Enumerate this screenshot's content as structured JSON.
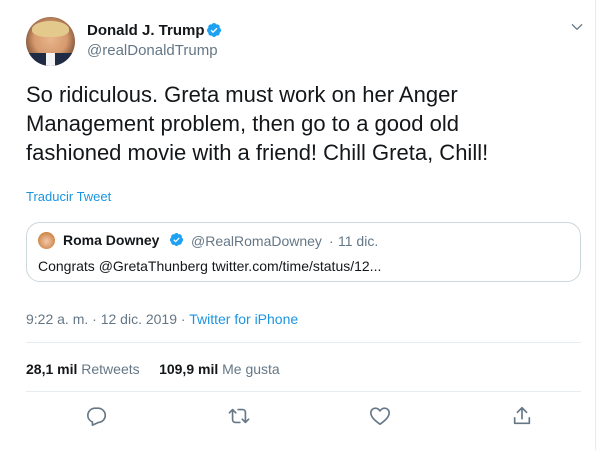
{
  "author": {
    "name": "Donald J. Trump",
    "handle": "@realDonaldTrump",
    "verified": true
  },
  "tweet": {
    "lines": [
      "So ridiculous. Greta must work on her Anger",
      "Management problem, then go to a good old",
      "fashioned movie with a friend! Chill Greta, Chill!"
    ],
    "translate_label": "Traducir Tweet"
  },
  "quoted": {
    "name": "Roma Downey",
    "handle": "@RealRomaDowney",
    "separator": "·",
    "date": "11 dic.",
    "text": "Congrats @GretaThunberg twitter.com/time/status/12..."
  },
  "meta": {
    "time": "9:22 a. m.",
    "separator": "·",
    "date": "12 dic. 2019",
    "separator2": "·",
    "source": "Twitter for iPhone"
  },
  "stats": {
    "retweets_count": "28,1 mil",
    "retweets_label": "Retweets",
    "likes_count": "109,9 mil",
    "likes_label": "Me gusta"
  },
  "icons": {
    "reply": "reply-icon",
    "retweet": "retweet-icon",
    "like": "like-icon",
    "share": "share-icon",
    "verified": "verified-badge-icon",
    "menu": "chevron-down-icon"
  },
  "colors": {
    "accent": "#1b95e0",
    "verified": "#1da1f2",
    "muted": "#657786",
    "text": "#14171a",
    "border": "#e6ecf0"
  }
}
